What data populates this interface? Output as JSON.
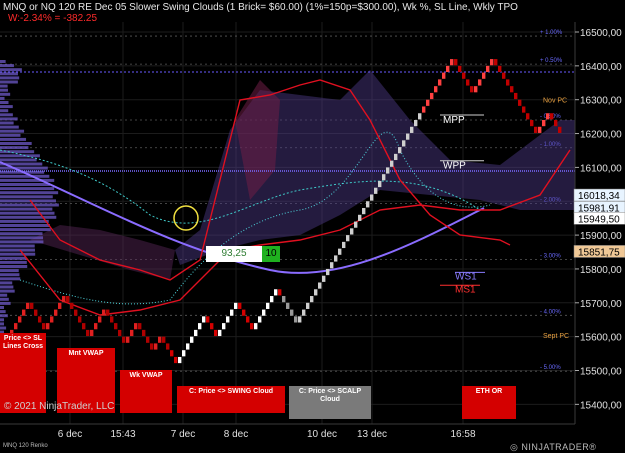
{
  "header": {
    "line1": "MNQ or NQ 120 RE Dec 05 Slower Swing Clouds (1 Brick= $60.00) (1%=150p=$300.00), Wk %, SL Line, Wkly TPO",
    "line2": "W:-2.34% = -382.25"
  },
  "copyright": "© 2021 NinjaTrader, LLC",
  "instrument": "MNQ 120 Renko",
  "brand": "◎ NINJATRADER®",
  "buttons": {
    "price_sl": "Price <> SL Lines Cross",
    "mnt_vwap": "Mnt VWAP",
    "wk_vwap": "Wk VWAP",
    "swing_cloud": "C: Price <> SWING Cloud",
    "scalp_cloud": "C: Price <> SCALP Cloud",
    "eth_or": "ETH OR"
  },
  "callout": {
    "value": "93,25",
    "count": "10"
  },
  "chart_data": {
    "type": "renko",
    "ylim": [
      15360,
      16520
    ],
    "y_ticks": [
      15400,
      15500,
      15600,
      15700,
      15800,
      15900,
      16000,
      16100,
      16200,
      16300,
      16400,
      16500
    ],
    "y_tick_labels": [
      "15400,00",
      "15500,00",
      "15600,00",
      "15700,00",
      "15800,00",
      "15900,00",
      "16000,00",
      "16100,00",
      "16200,00",
      "16300,00",
      "16400,00",
      "16500,00"
    ],
    "x_ticks": [
      "6 dec",
      "15:43",
      "7 dec",
      "8 dec",
      "10 dec",
      "13 dec",
      "16:58"
    ],
    "price_markers": [
      {
        "label": "16018,34",
        "value": 16018.34,
        "color": "#e8f4ff"
      },
      {
        "label": "15981,91",
        "value": 15981.91,
        "color": "#e8f4ff"
      },
      {
        "label": "15949,50",
        "value": 15949.5,
        "color": "#ffffff"
      },
      {
        "label": "15851,75",
        "value": 15851.75,
        "color": "#f0c896"
      }
    ],
    "pct_levels": [
      {
        "label": "+ 1.00%",
        "value": 16488
      },
      {
        "label": "+ 0.50%",
        "value": 16405
      },
      {
        "label": "- 0.50%",
        "value": 16240
      },
      {
        "label": "- 1.00%",
        "value": 16158
      },
      {
        "label": "- 2.00%",
        "value": 15993
      },
      {
        "label": "- 3.00%",
        "value": 15828
      },
      {
        "label": "- 4.00%",
        "value": 15663
      },
      {
        "label": "- 5.00%",
        "value": 15498
      }
    ],
    "level_labels": [
      {
        "label": "Nov PC",
        "value": 16300,
        "color": "#e8a040"
      },
      {
        "label": "Sept PC",
        "value": 15605,
        "color": "#e8a040"
      },
      {
        "label": "MPP",
        "value": 16240,
        "color": "#ffffff"
      },
      {
        "label": "WPP",
        "value": 16105,
        "color": "#ffffff"
      },
      {
        "label": "WS1",
        "value": 15778,
        "color": "#8a7cff"
      },
      {
        "label": "MS1",
        "value": 15740,
        "color": "#ff3030"
      }
    ],
    "renko_path": [
      15600,
      15700,
      15620,
      15720,
      15600,
      15680,
      15580,
      15640,
      15560,
      15600,
      15520,
      15660,
      15600,
      15700,
      15620,
      15740,
      15640,
      16000,
      16120,
      16420,
      16320,
      16420,
      16200,
      16260,
      16180,
      16300,
      16200,
      16380,
      16200,
      16360,
      16140,
      16280,
      16160,
      16240,
      16140,
      16300,
      16180,
      16400,
      16300,
      16320,
      16180,
      16240,
      16060,
      16100,
      15960,
      15980,
      15900,
      15960,
      15880,
      15800,
      15900,
      15960
    ]
  }
}
